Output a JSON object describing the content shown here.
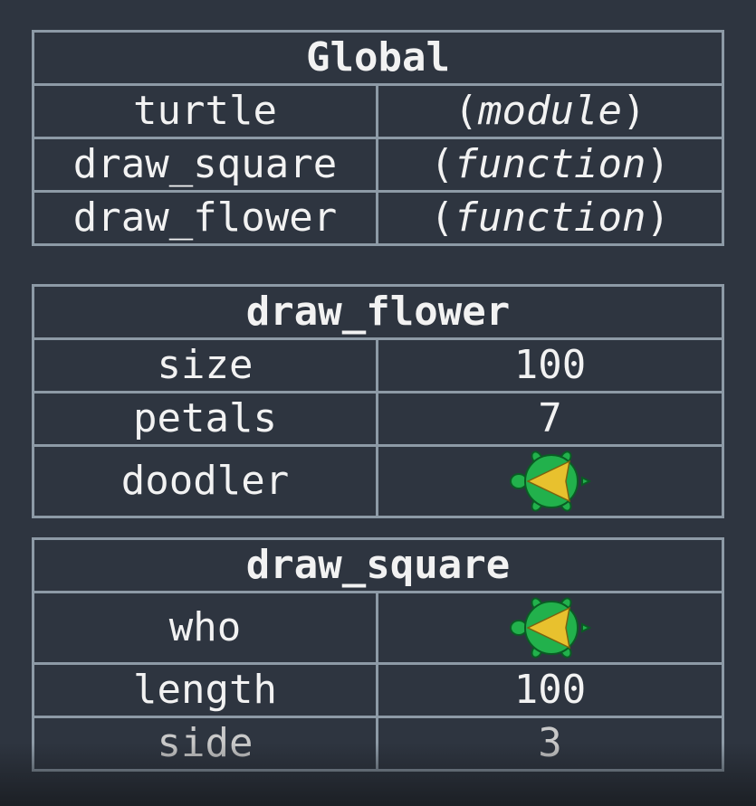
{
  "frames": {
    "global": {
      "title": "Global",
      "rows": [
        {
          "name": "turtle",
          "value": "module",
          "open": "(",
          "close": ")"
        },
        {
          "name": "draw_square",
          "value": "function",
          "open": "(",
          "close": ")"
        },
        {
          "name": "draw_flower",
          "value": "function",
          "open": "(",
          "close": ")"
        }
      ]
    },
    "draw_flower": {
      "title": "draw_flower",
      "rows": [
        {
          "name": "size",
          "value": "100"
        },
        {
          "name": "petals",
          "value": "7"
        },
        {
          "name": "doodler",
          "icon": "turtle-icon"
        }
      ]
    },
    "draw_square": {
      "title": "draw_square",
      "rows": [
        {
          "name": "who",
          "icon": "turtle-icon"
        },
        {
          "name": "length",
          "value": "100"
        },
        {
          "name": "side",
          "value": "3"
        }
      ]
    }
  },
  "colors": {
    "background": "#2e3540",
    "border": "#8d9aa6",
    "text": "#f2f2f2",
    "turtle_body": "#22b14c",
    "turtle_outline": "#0a5c24",
    "turtle_arrow": "#e8c12e"
  }
}
